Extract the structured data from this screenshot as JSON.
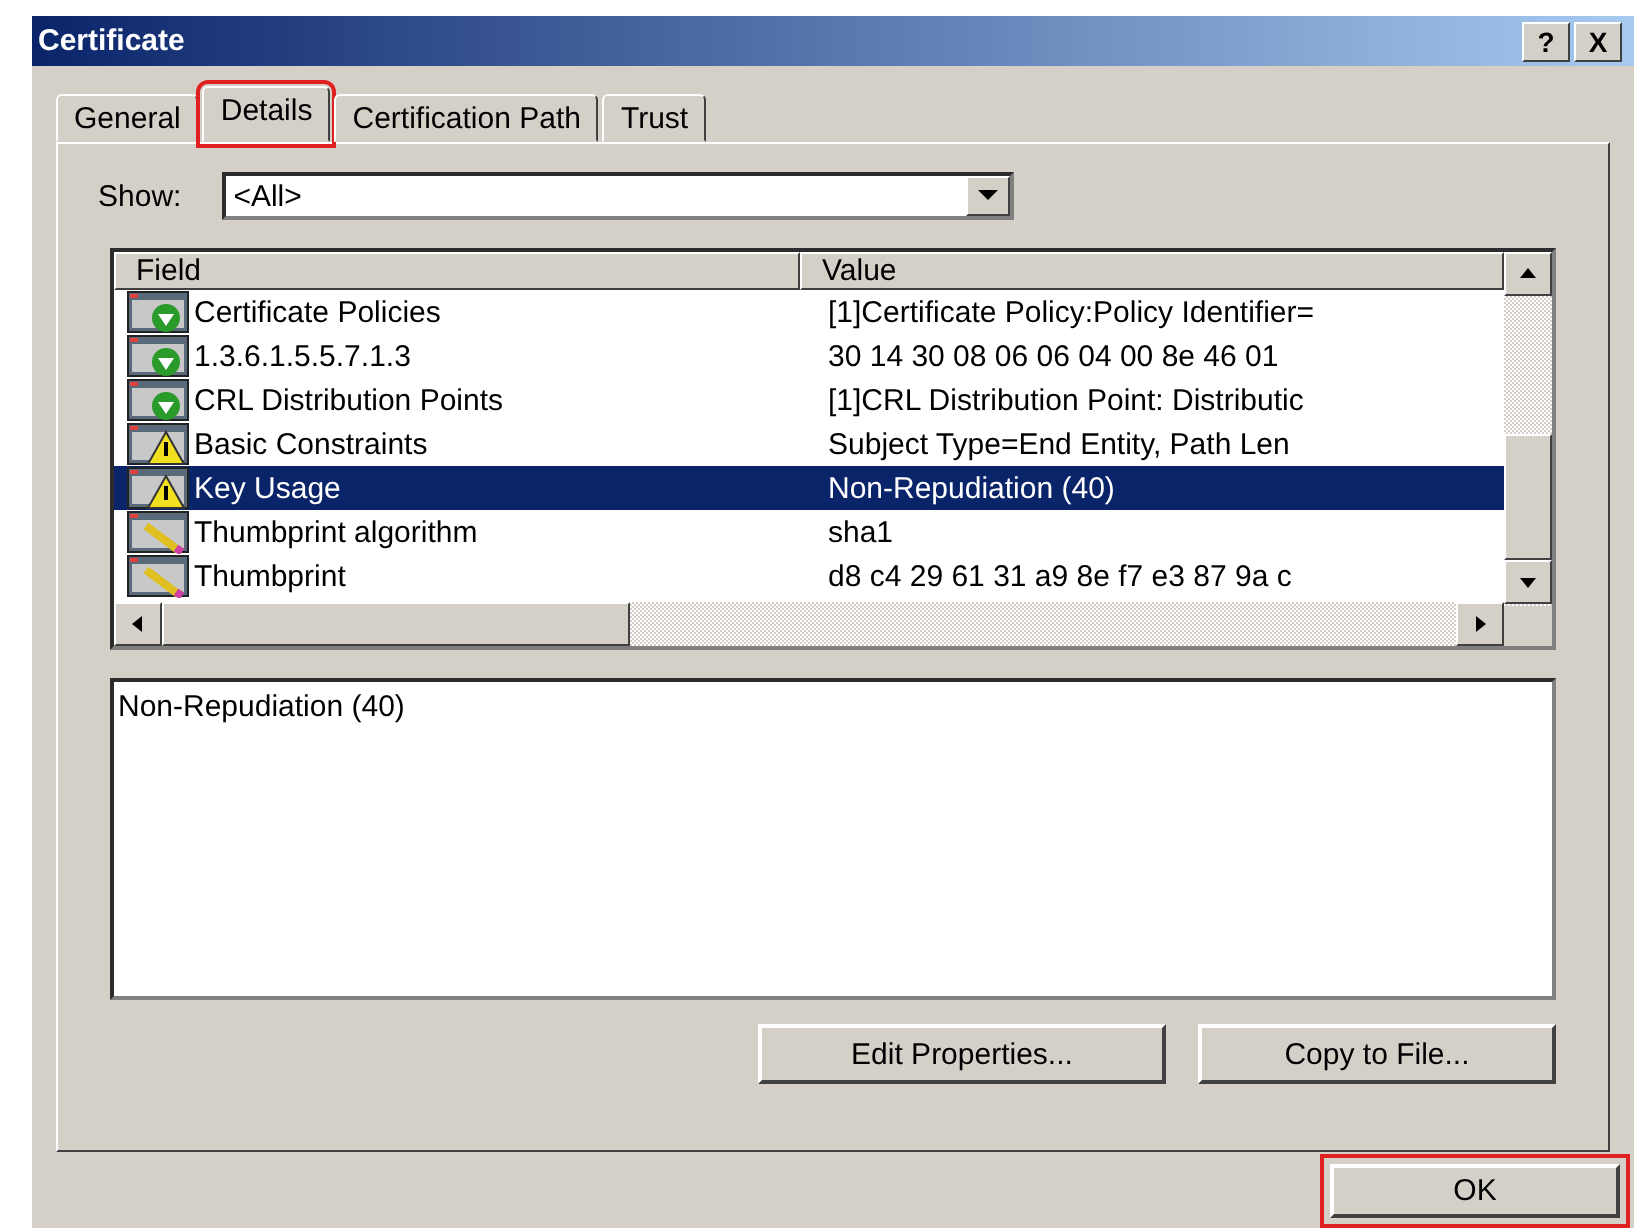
{
  "window": {
    "title": "Certificate",
    "buttons": [
      "?",
      "X"
    ]
  },
  "tabs": [
    {
      "label": "General",
      "selected": false,
      "highlighted": false
    },
    {
      "label": "Details",
      "selected": true,
      "highlighted": true
    },
    {
      "label": "Certification Path",
      "selected": false,
      "highlighted": false
    },
    {
      "label": "Trust",
      "selected": false,
      "highlighted": false
    }
  ],
  "show": {
    "label": "Show:",
    "value": "<All>"
  },
  "table": {
    "columns": [
      "Field",
      "Value"
    ],
    "rows": [
      {
        "kind": "extension",
        "field": "Certificate Policies",
        "value": "[1]Certificate Policy:Policy Identifier=",
        "selected": false
      },
      {
        "kind": "extension",
        "field": "1.3.6.1.5.5.7.1.3",
        "value": "30 14 30 08 06 06 04 00 8e 46 01",
        "selected": false
      },
      {
        "kind": "extension",
        "field": "CRL Distribution Points",
        "value": "[1]CRL Distribution Point: Distributic",
        "selected": false
      },
      {
        "kind": "critical",
        "field": "Basic Constraints",
        "value": "Subject Type=End Entity, Path Len",
        "selected": false
      },
      {
        "kind": "critical",
        "field": "Key Usage",
        "value": "Non-Repudiation (40)",
        "selected": true
      },
      {
        "kind": "property",
        "field": "Thumbprint algorithm",
        "value": "sha1",
        "selected": false
      },
      {
        "kind": "property",
        "field": "Thumbprint",
        "value": "d8 c4 29 61 31 a9 8e f7 e3 87 9a c",
        "selected": false
      }
    ]
  },
  "detail": {
    "text": "Non-Repudiation (40)"
  },
  "buttons": [
    "Edit Properties...",
    "Copy to File..."
  ],
  "footer_button": {
    "label": "OK",
    "highlighted": true
  }
}
